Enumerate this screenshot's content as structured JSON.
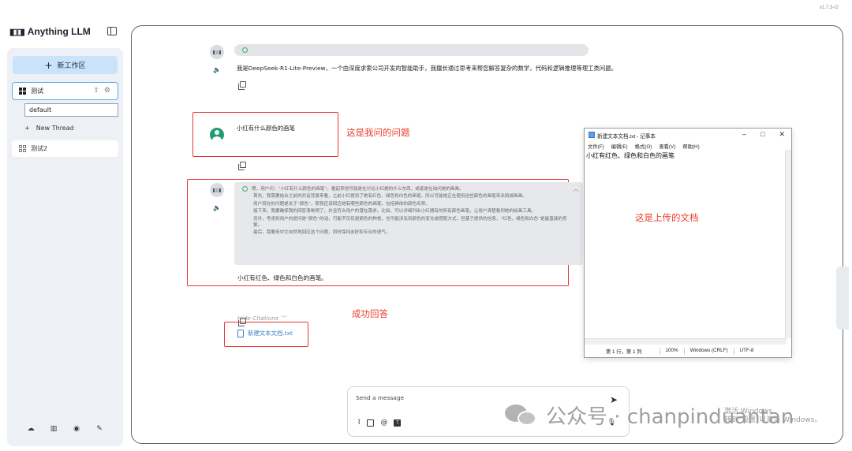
{
  "version": "v1.7.3-r2",
  "sidebar": {
    "brand": "Anything LLM",
    "new_workspace": "新工作区",
    "workspaces": [
      {
        "name": "测试",
        "active": true,
        "threads": [
          {
            "name": "default"
          }
        ],
        "new_thread": "New Thread"
      },
      {
        "name": "测试2",
        "active": false
      }
    ],
    "footer_icons": [
      "community-icon",
      "docs-icon",
      "discord-icon",
      "settings-wrench-icon"
    ]
  },
  "chat": {
    "messages": [
      {
        "role": "assistant",
        "text": "我是DeepSeek-R1-Lite-Preview，一个由深度求索公司开发的智能助手，我擅长通过思考来帮您解答复杂的数学，代码和逻辑推理等理工类问题。"
      },
      {
        "role": "user",
        "text": "小红有什么颜色的画笔"
      },
      {
        "role": "assistant",
        "thinking": [
          "嗯，用户问：“小红有什么颜色的画笔”。看起来他可能是在讨论小红拥的什么东西，或者是在询问她的画具。",
          "首先，我需要结合之前的对话背景来看，之前小红提到了她有红色、绿色和白色的画笔。所以可能她正在使用这些颜色的画笔来涂鸦或画画。",
          "用户现在的问题是关于“颜色”，那我应该回应她有哪些颜色的画笔，包括具体的颜色名称。",
          "接下来，我要确保我的回答清晰明了，并且符合用户的潜在需求。比如，可以详细列出小红拥有的所有颜色画笔，让用户清楚看到她的绘画工具。",
          "另外，考虑到用户的提问是“颜色”的话，可能不仅仅是颜色的种类，也可能涉及到颜色的变化或搭配方式，但基于提供的信息，“红色，绿色和白色”是最直接的答案。",
          "最后，我要用中文自然地回应这个问题，同时保持友好和专业的语气。"
        ],
        "text": "小红有红色、绿色和白色的画笔。",
        "hide_citations": "Hide Citations",
        "citation_file": "新建文本文档.txt"
      }
    ],
    "input": {
      "placeholder": "Send a message"
    }
  },
  "annotations": {
    "question_note": "这是我问的问题",
    "document_note": "这是上传的文档",
    "success_note": "成功回答"
  },
  "notepad": {
    "title": "新建文本文档.txt - 记事本",
    "menu": [
      "文件(F)",
      "编辑(E)",
      "格式(O)",
      "查看(V)",
      "帮助(H)"
    ],
    "content": "小红有红色、绿色和白色的画笔",
    "status": {
      "position": "第 1 行，第 1 列",
      "zoom": "100%",
      "line_ending": "Windows (CRLF)",
      "encoding": "UTF-8"
    }
  },
  "watermark": {
    "text": "公众号 · chanpinduantan",
    "windows_activate_1": "激活 Windows",
    "windows_activate_2": "转到\"设置\"以激活 Windows。"
  },
  "colors": {
    "accent_blue": "#c9e3fb",
    "annotation_red": "#e83535",
    "citation_blue": "#3b82c4"
  }
}
